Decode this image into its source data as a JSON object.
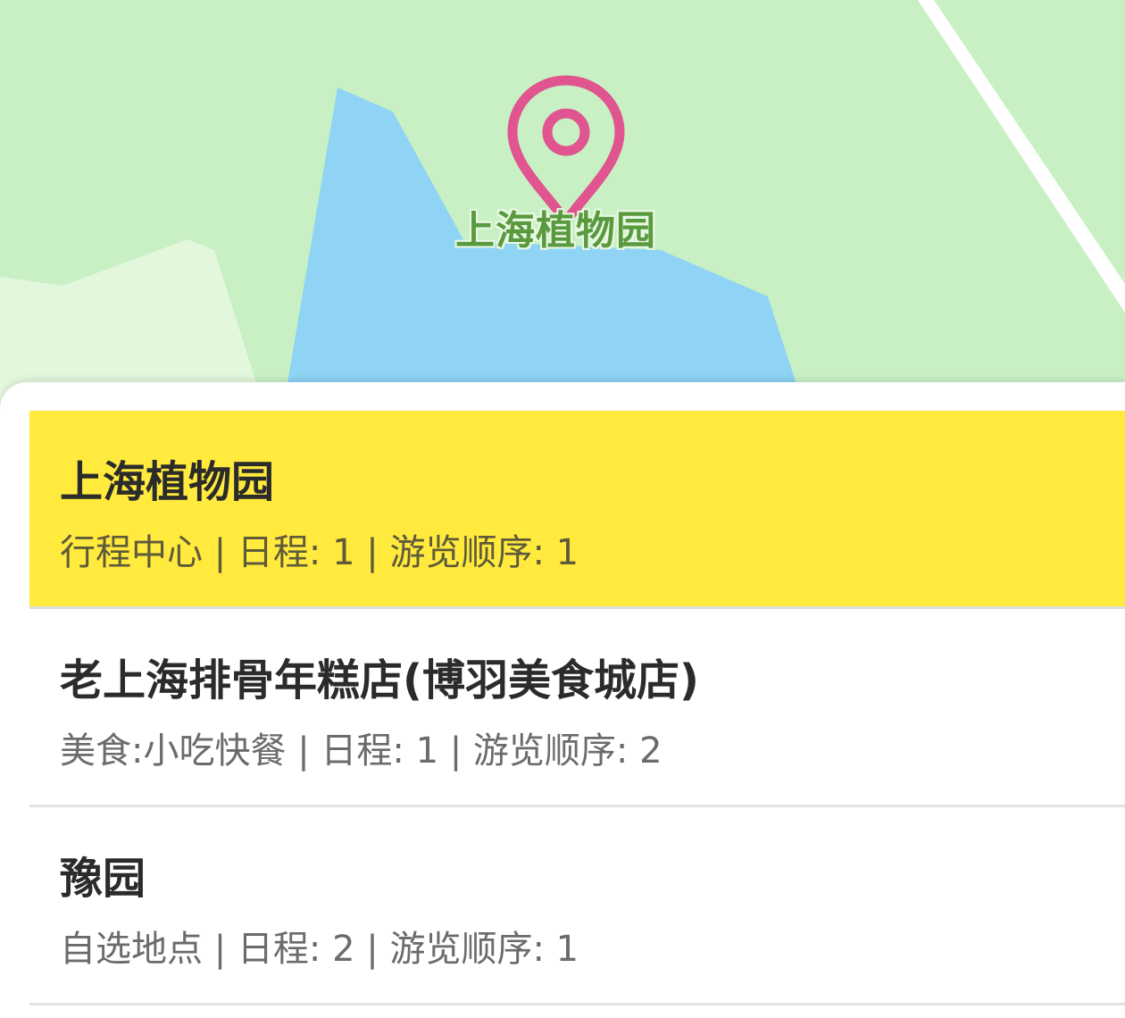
{
  "map": {
    "place_label": "上海植物园",
    "colors": {
      "land": "#c9f0c4",
      "water": "#8fd3f5",
      "road": "#ffffff",
      "label": "#5a9a3f",
      "pin": "#e0548f"
    },
    "marker_icon": "map-pin-icon"
  },
  "list": {
    "items": [
      {
        "title": "上海植物园",
        "subtitle": "行程中心 | 日程: 1 | 游览顺序: 1",
        "selected": true
      },
      {
        "title": "老上海排骨年糕店(博羽美食城店)",
        "subtitle": "美食:小吃快餐 | 日程: 1 | 游览顺序: 2",
        "selected": false
      },
      {
        "title": "豫园",
        "subtitle": "自选地点 | 日程: 2 | 游览顺序: 1",
        "selected": false
      }
    ],
    "highlight_color": "#ffea3d"
  }
}
